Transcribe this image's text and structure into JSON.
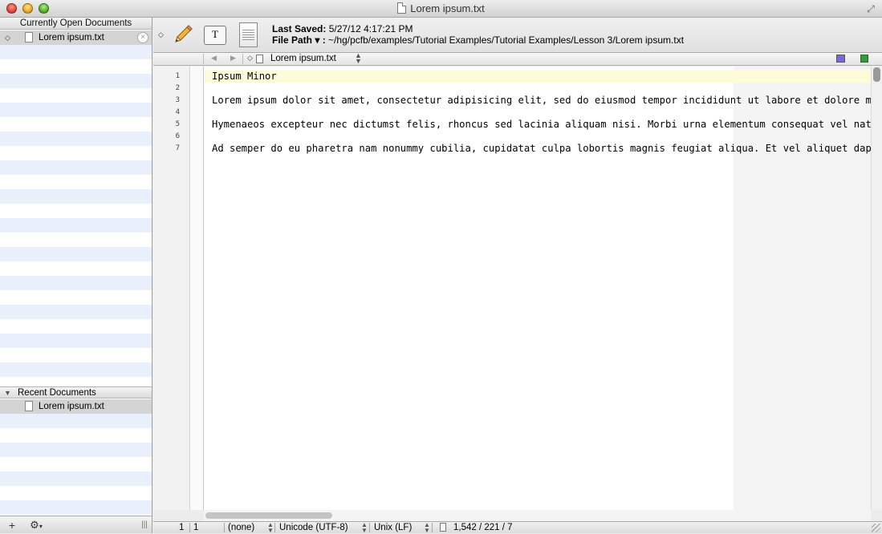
{
  "window": {
    "title": "Lorem ipsum.txt"
  },
  "sidebar": {
    "open_header": "Currently Open Documents",
    "open_documents": [
      {
        "label": "Lorem ipsum.txt"
      }
    ],
    "recent_header": "Recent Documents",
    "recent_documents": [
      {
        "label": "Lorem ipsum.txt"
      }
    ],
    "add_label": "+",
    "gear_label": "⚙",
    "gear_caret": "▾",
    "splitter_label": "|||"
  },
  "toolbar": {
    "last_saved_label": "Last Saved:",
    "last_saved_value": "5/27/12 4:17:21 PM",
    "file_path_label": "File Path ▾ :",
    "file_path_value": "~/hg/pcfb/examples/Tutorial Examples/Tutorial Examples/Lesson 3/Lorem ipsum.txt",
    "text_options_glyph": "T"
  },
  "navbar": {
    "back_glyph": "◀",
    "forward_glyph": "▶",
    "document_name": "Lorem ipsum.txt"
  },
  "editor": {
    "line_numbers": [
      "1",
      "2",
      "3",
      "4",
      "5",
      "6",
      "7"
    ],
    "lines": [
      "Ipsum Minor",
      "",
      "Lorem ipsum dolor sit amet, consectetur adipisicing elit, sed do eiusmod tempor incididunt ut labore et dolore magna aliqua.",
      "",
      "Hymenaeos excepteur nec dictumst felis, rhoncus sed lacinia aliquam nisi. Morbi urna elementum consequat vel natoque.",
      "",
      "Ad semper do eu pharetra nam nonummy cubilia, cupidatat culpa lobortis magnis feugiat aliqua. Et vel aliquet dapibus."
    ],
    "highlight_color": "#fefcd8"
  },
  "statusbar": {
    "line": "1",
    "column": "1",
    "language": "(none)",
    "encoding": "Unicode (UTF-8)",
    "line_endings": "Unix (LF)",
    "stats": "1,542 / 221 / 7"
  }
}
